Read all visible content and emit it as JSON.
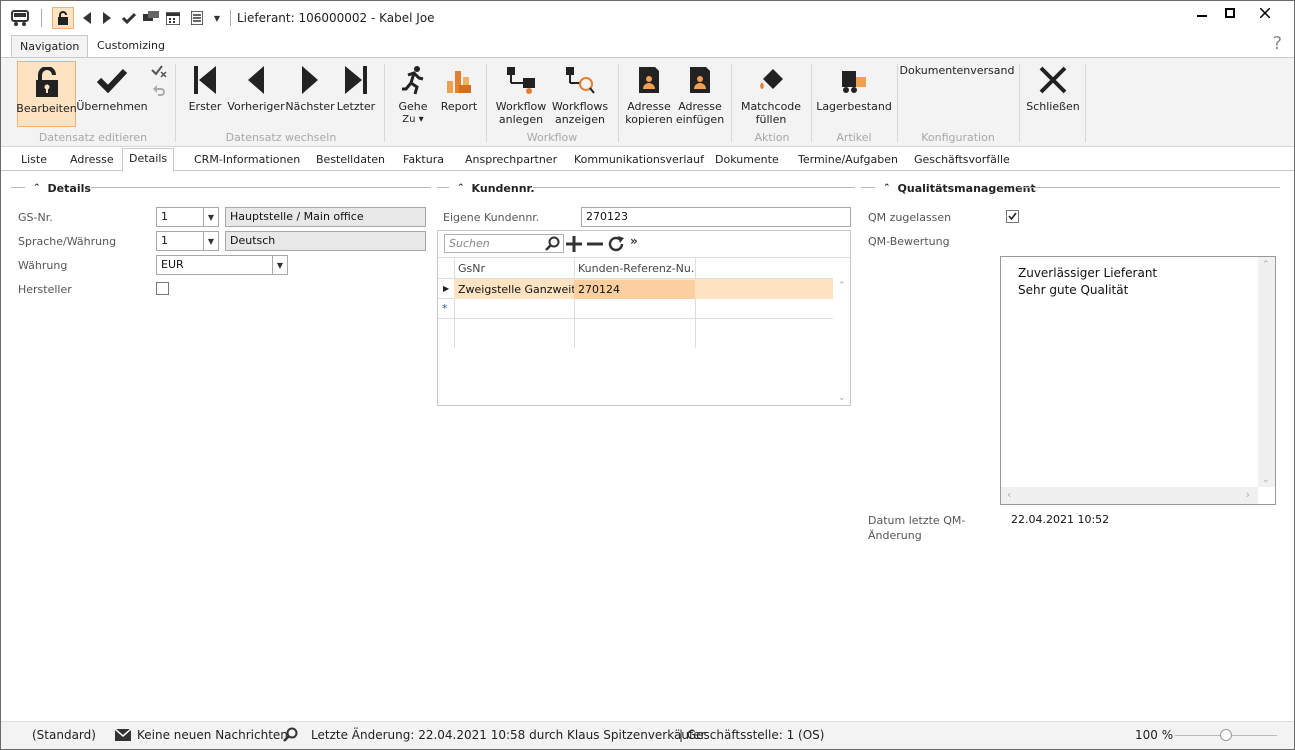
{
  "window": {
    "title": "Lieferant: 106000002 - Kabel Joe"
  },
  "ribbon_tabs": [
    "Navigation",
    "Customizing"
  ],
  "ribbon": {
    "buttons": {
      "edit": "Bearbeiten",
      "accept": "Übernehmen",
      "first": "Erster",
      "prev": "Vorheriger",
      "next": "Nächster",
      "last": "Letzter",
      "goto1": "Gehe",
      "goto2": "Zu ▾",
      "report": "Report",
      "wf_create1": "Workflow",
      "wf_create2": "anlegen",
      "wf_show1": "Workflows",
      "wf_show2": "anzeigen",
      "addr_copy1": "Adresse",
      "addr_copy2": "kopieren",
      "addr_paste1": "Adresse",
      "addr_paste2": "einfügen",
      "matchcode1": "Matchcode",
      "matchcode2": "füllen",
      "stock": "Lagerbestand",
      "docship": "Dokumentenversand",
      "close": "Schließen"
    },
    "groups": {
      "g1": "Datensatz editieren",
      "g2": "Datensatz wechseln",
      "g3": "Workflow",
      "g4": "Aktion",
      "g5": "Artikel",
      "g6": "Konfiguration"
    }
  },
  "tabs": [
    "Liste",
    "Adresse",
    "Details",
    "CRM-Informationen",
    "Bestelldaten",
    "Faktura",
    "Ansprechpartner",
    "Kommunikationsverlauf",
    "Dokumente",
    "Termine/Aufgaben",
    "Geschäftsvorfälle"
  ],
  "details": {
    "section": "Details",
    "gs_label": "GS-Nr.",
    "gs_value": "1",
    "gs_name": "Hauptstelle / Main office",
    "lang_label": "Sprache/Währung",
    "lang_value": "1",
    "lang_name": "Deutsch",
    "currency_label": "Währung",
    "currency_value": "EUR",
    "manufacturer_label": "Hersteller"
  },
  "kunden": {
    "section": "Kundennr.",
    "own_label": "Eigene Kundennr.",
    "own_value": "270123",
    "search_placeholder": "Suchen",
    "columns": [
      "GsNr",
      "Kunden-Referenz-Nu..."
    ],
    "rows": [
      {
        "gsnr": "Zweigstelle Ganzweit...",
        "ref": "270124"
      }
    ]
  },
  "qm": {
    "section": "Qualitätsmanagement",
    "allowed_label": "QM zugelassen",
    "rating_label": "QM-Bewertung",
    "rating_line1": "Zuverlässiger Lieferant",
    "rating_line2": "Sehr gute Qualität",
    "date_label1": "Datum letzte QM-",
    "date_label2": "Änderung",
    "date_value": "22.04.2021 10:52"
  },
  "status": {
    "profile": "(Standard)",
    "messages": "Keine neuen Nachrichten",
    "last_change": "Letzte Änderung: 22.04.2021 10:58 durch Klaus Spitzenverkäufer",
    "branch": "| Geschäftsstelle:  1 (OS)",
    "zoom": "100 %"
  },
  "help": "?"
}
